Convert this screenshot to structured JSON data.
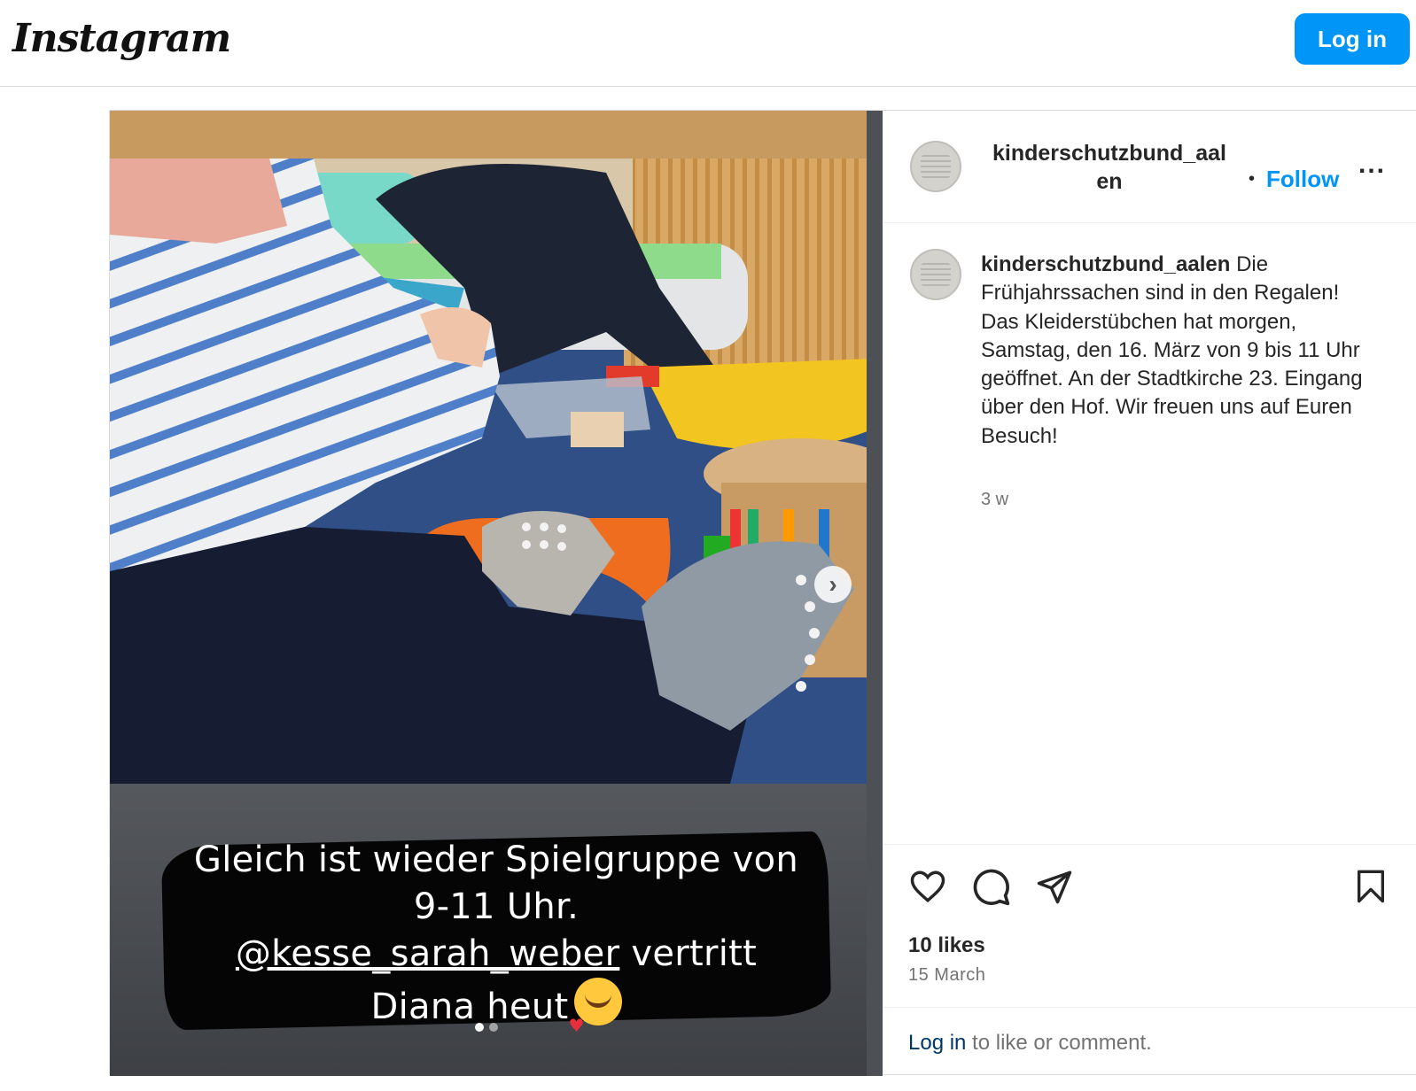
{
  "app": {
    "logo": "Instagram",
    "login_button": "Log in"
  },
  "post": {
    "username": "kinderschutzbund_aalen",
    "username_line1": "kinderschutzbund_aal",
    "username_line2": "en",
    "follow_label": "Follow",
    "more_label": "...",
    "caption_text": "Die Frühjahrssachen sind in den Regalen! Das Kleiderstübchen hat morgen, Samstag, den 16. März von 9 bis 11 Uhr geöffnet. An der Stadtkirche 23. Eingang über den Hof. Wir freuen uns auf Euren Besuch!",
    "time_ago": "3 w",
    "likes": "10 likes",
    "date": "15 March",
    "login_prompt_link": "Log in",
    "login_prompt_text": " to like or comment."
  },
  "media": {
    "overlay_line1": "Gleich ist wieder Spielgruppe von",
    "overlay_line2": "9-11 Uhr.",
    "overlay_mention": "@kesse_sarah_weber",
    "overlay_line3_rest": " vertritt",
    "overlay_line4": "Diana heut",
    "carousel_count": 2,
    "carousel_active": 1
  },
  "icons": [
    "heart-icon",
    "comment-icon",
    "share-icon",
    "bookmark-icon",
    "chevron-right-icon",
    "more-icon"
  ],
  "colors": {
    "primary_blue": "#0095f6",
    "link_dark": "#00376b",
    "text": "#262626",
    "muted": "#737373"
  }
}
